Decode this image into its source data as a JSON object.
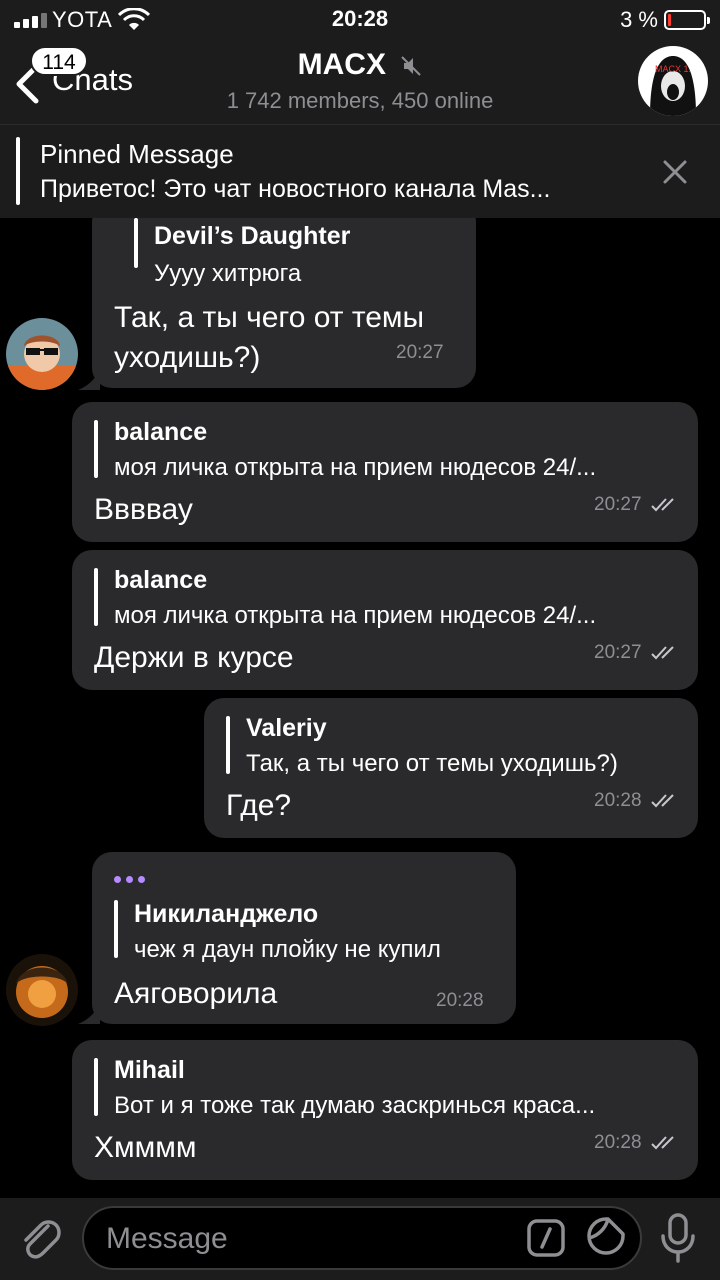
{
  "status": {
    "carrier": "YOTA",
    "time": "20:28",
    "battery_percent": "3 %",
    "battery_level": 0.03
  },
  "nav": {
    "back_label": "Chats",
    "unread_badge": "114",
    "title": "MACX",
    "subtitle": "1 742 members, 450 online",
    "avatar_text": "MACX 1."
  },
  "pinned": {
    "title": "Pinned Message",
    "text": "Приветос! Это чат новостного канала Mas..."
  },
  "messages": [
    {
      "reply_name": "Devil’s Daughter",
      "reply_text": "Уууу хитрюга",
      "text_line1": "Так, а ты чего от темы",
      "text_line2": "уходишь?)",
      "time": "20:27"
    },
    {
      "reply_name": "balance",
      "reply_text": "моя личка открыта на прием нюдесов 24/...",
      "text": "Ввввау",
      "time": "20:27"
    },
    {
      "reply_name": "balance",
      "reply_text": "моя личка открыта на прием нюдесов 24/...",
      "text": "Держи в курсе",
      "time": "20:27"
    },
    {
      "reply_name": "Valeriy",
      "reply_text": "Так, а ты чего от темы уходишь?)",
      "text": "Где?",
      "time": "20:28"
    },
    {
      "reply_name": "Никиланджело",
      "reply_text": "чеж я даун плойку не купил",
      "text": "Аяговорила",
      "time": "20:28"
    },
    {
      "reply_name": "Mihail",
      "reply_text": "Вот и я тоже так думаю заскринься краса...",
      "text": "Хмммм",
      "time": "20:28"
    }
  ],
  "input": {
    "placeholder": "Message"
  }
}
